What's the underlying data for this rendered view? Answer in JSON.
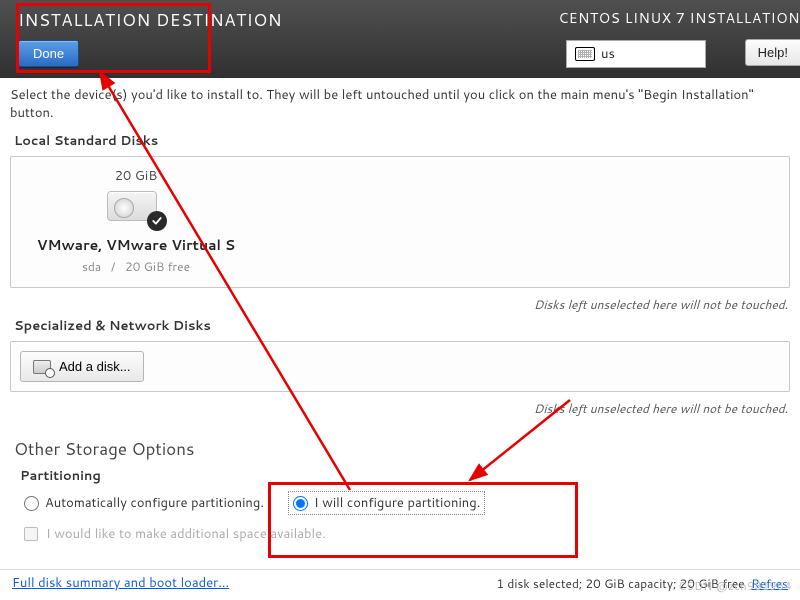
{
  "header": {
    "title": "INSTALLATION DESTINATION",
    "right_title": "CENTOS LINUX 7 INSTALLATION",
    "done": "Done",
    "help": "Help!",
    "kbd_layout": "us"
  },
  "intro": "Select the device(s) you'd like to install to.  They will be left untouched until you click on the main menu's \"Begin Installation\" button.",
  "sections": {
    "local_disks": "Local Standard Disks",
    "specialized": "Specialized & Network Disks",
    "hint": "Disks left unselected here will not be touched."
  },
  "disk": {
    "capacity": "20 GiB",
    "name": "VMware, VMware Virtual S",
    "id": "sda",
    "sep": "/",
    "free": "20 GiB free"
  },
  "add_disk": "Add a disk...",
  "storage": {
    "title": "Other Storage Options",
    "partitioning_label": "Partitioning",
    "auto": "Automatically configure partitioning.",
    "manual": "I will configure partitioning.",
    "extra_space": "I would like to make additional space available."
  },
  "footer": {
    "link": "Full disk summary and boot loader...",
    "status": "1 disk selected; 20 GiB capacity; 20 GiB free",
    "refresh": "Refres"
  },
  "watermark": "CSDN @zch981964"
}
